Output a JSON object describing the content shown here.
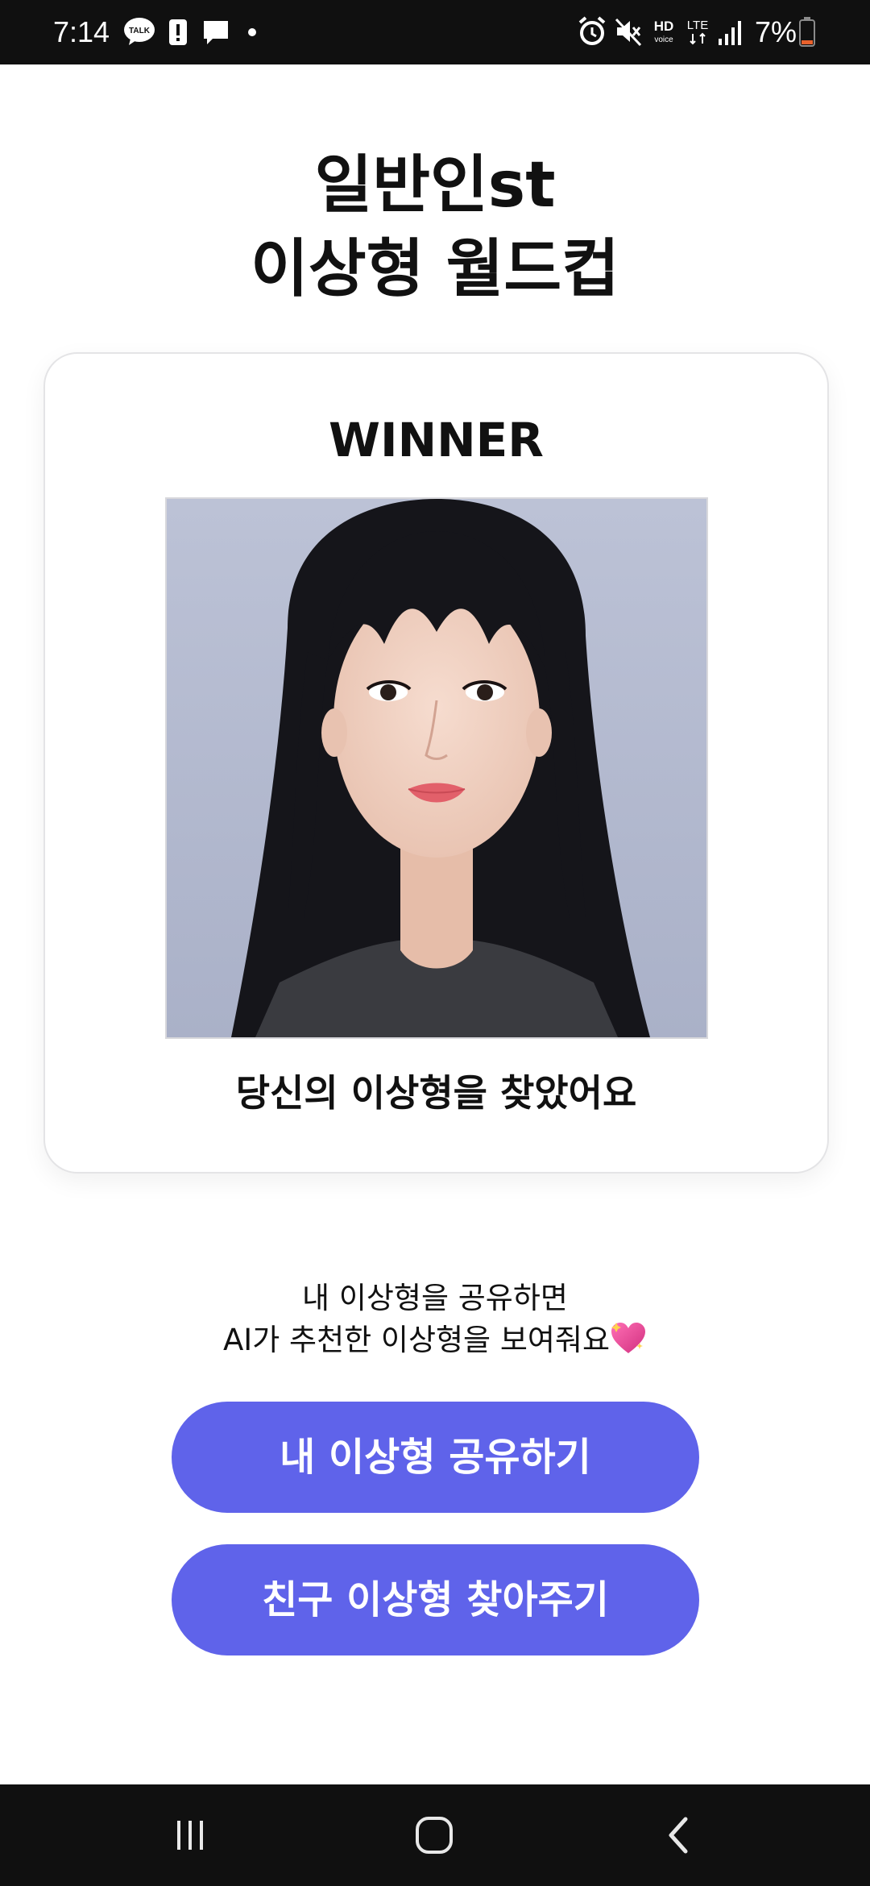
{
  "status_bar": {
    "time": "7:14",
    "battery": "7%",
    "network_label_top": "HD",
    "network_label_sub": "voice",
    "lte_label": "LTE"
  },
  "page": {
    "title_line1": "일반인st",
    "title_line2": "이상형 월드컵"
  },
  "card": {
    "heading": "WINNER",
    "caption": "당신의 이상형을 찾았어요"
  },
  "share": {
    "line1": "내 이상형을 공유하면",
    "line2": "AI가 추천한 이상형을 보여줘요"
  },
  "buttons": {
    "share_label": "내 이상형 공유하기",
    "friend_label": "친구 이상형 찾아주기"
  },
  "colors": {
    "accent": "#5f63ea",
    "status_bar_bg": "#101010",
    "card_border": "#e4e4e6"
  },
  "icons": {
    "talk": "kakaotalk-icon",
    "alert": "alert-icon",
    "message": "message-icon",
    "alarm": "alarm-icon",
    "mute": "mute-icon",
    "signal": "signal-icon",
    "battery": "battery-icon",
    "heart": "sparkling-heart-icon",
    "nav_recents": "recents-icon",
    "nav_home": "home-icon",
    "nav_back": "back-icon"
  }
}
